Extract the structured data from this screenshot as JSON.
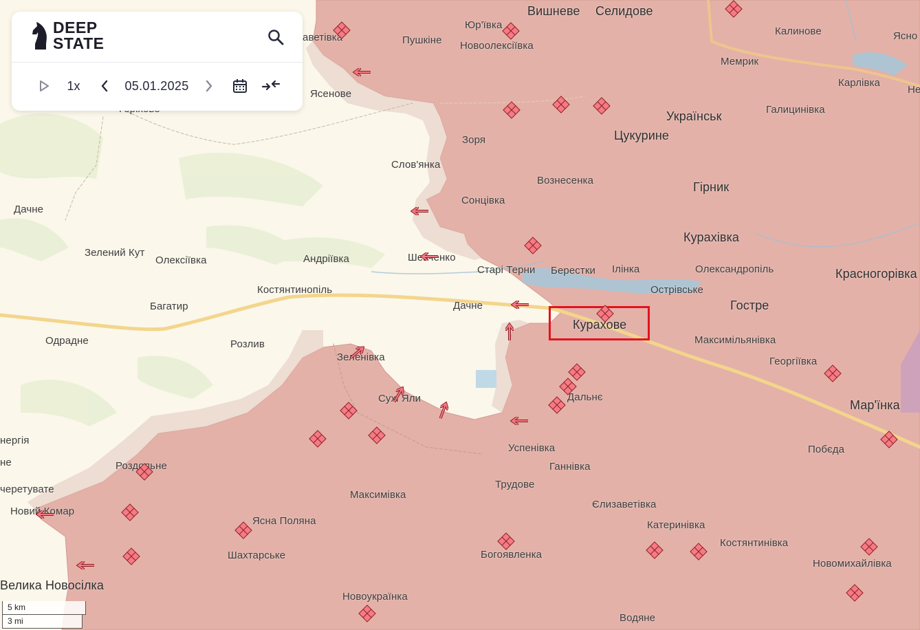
{
  "app": {
    "logo_line1": "DEEP",
    "logo_line2": "STATE",
    "speed": "1x",
    "date": "05.01.2025"
  },
  "scale": {
    "km": "5 km",
    "mi": "3 mi"
  },
  "colors": {
    "occupied": "#e3b1a8",
    "grey_zone": "#ebd9cf",
    "free_territory": "#fbf7ea",
    "marker": "#f47b84",
    "highlight": "#e2131f"
  },
  "map_labels": [
    "Вишневе",
    "Селидове",
    "Юр'ївка",
    "Пушкіне",
    "Новоолексіївка",
    "Калинове",
    "Ясно",
    "Мемрик",
    "Карлівка",
    "Не",
    "аветівка",
    "Ясенове",
    "Горіхове",
    "Українськ",
    "Галицинівка",
    "Цукурине",
    "Зоря",
    "Слов'янка",
    "Вознесенка",
    "Гірник",
    "Сонцівка",
    "Дачне",
    "Курахівка",
    "Зелений Кут",
    "Олексіївка",
    "Андріївка",
    "Шевченко",
    "Старі Терни",
    "Берестки",
    "Ілінка",
    "Олександропіль",
    "Красногорівка",
    "Острівське",
    "Костянтинопіль",
    "Багатир",
    "Дачне",
    "Гостре",
    "Курахове",
    "Одрадне",
    "Розлив",
    "Максимільянівка",
    "Зеленівка",
    "Георгіївка",
    "Сухі Яли",
    "Дальнє",
    "Мар'їнка",
    "Успенівка",
    "Побєда",
    "Ганнівка",
    "Роздольне",
    "нергія",
    "не",
    "Трудове",
    "Максимівка",
    "черетувате",
    "Єлизаветівка",
    "Новий Комар",
    "Ясна Поляна",
    "Катеринівка",
    "Шахтарське",
    "Костянтинівка",
    "Богоявленка",
    "Новомихайлівка",
    "Велика Новосілка",
    "Новоукраїнка",
    "Водяне"
  ]
}
